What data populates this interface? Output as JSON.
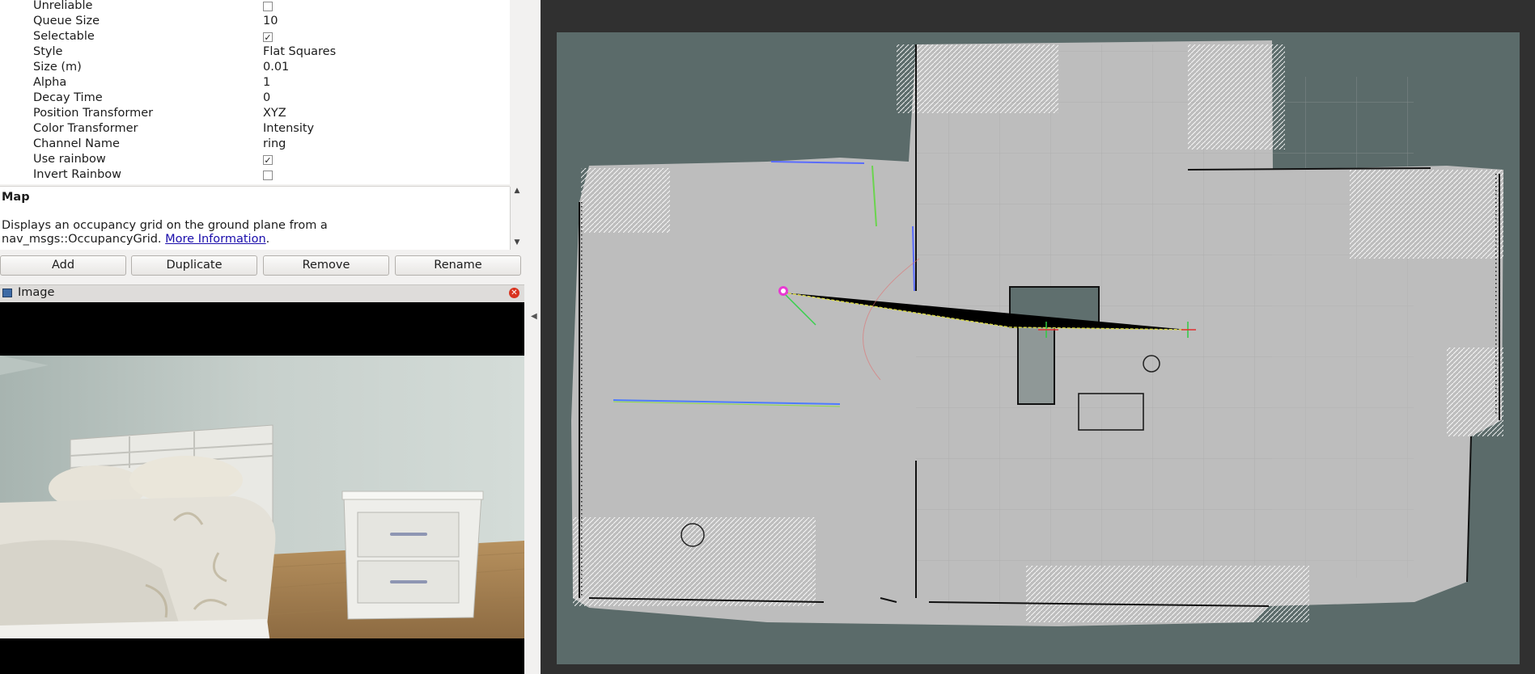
{
  "properties": {
    "rows": [
      {
        "name": "Unreliable",
        "type": "checkbox",
        "checked": false
      },
      {
        "name": "Queue Size",
        "type": "text",
        "value": "10"
      },
      {
        "name": "Selectable",
        "type": "checkbox",
        "checked": true
      },
      {
        "name": "Style",
        "type": "text",
        "value": "Flat Squares"
      },
      {
        "name": "Size (m)",
        "type": "text",
        "value": "0.01"
      },
      {
        "name": "Alpha",
        "type": "text",
        "value": "1"
      },
      {
        "name": "Decay Time",
        "type": "text",
        "value": "0"
      },
      {
        "name": "Position Transformer",
        "type": "text",
        "value": "XYZ"
      },
      {
        "name": "Color Transformer",
        "type": "text",
        "value": "Intensity"
      },
      {
        "name": "Channel Name",
        "type": "text",
        "value": "ring"
      },
      {
        "name": "Use rainbow",
        "type": "checkbox",
        "checked": true
      },
      {
        "name": "Invert Rainbow",
        "type": "checkbox",
        "checked": false
      }
    ]
  },
  "description": {
    "title": "Map",
    "text": "Displays an occupancy grid on the ground plane from a nav_msgs::OccupancyGrid. ",
    "link": "More Information",
    "suffix": "."
  },
  "buttons": {
    "add": "Add",
    "duplicate": "Duplicate",
    "remove": "Remove",
    "rename": "Rename"
  },
  "image_panel": {
    "title": "Image"
  },
  "icons": {
    "check": "✓",
    "close": "✕",
    "arrow_up": "▲",
    "arrow_down": "▼",
    "collapse": "◀"
  },
  "colors": {
    "map_background": "#5b6b6a",
    "map_free": "#bdbdbd",
    "grid": "#a2a2a2",
    "panel": "#f2f1f0"
  }
}
